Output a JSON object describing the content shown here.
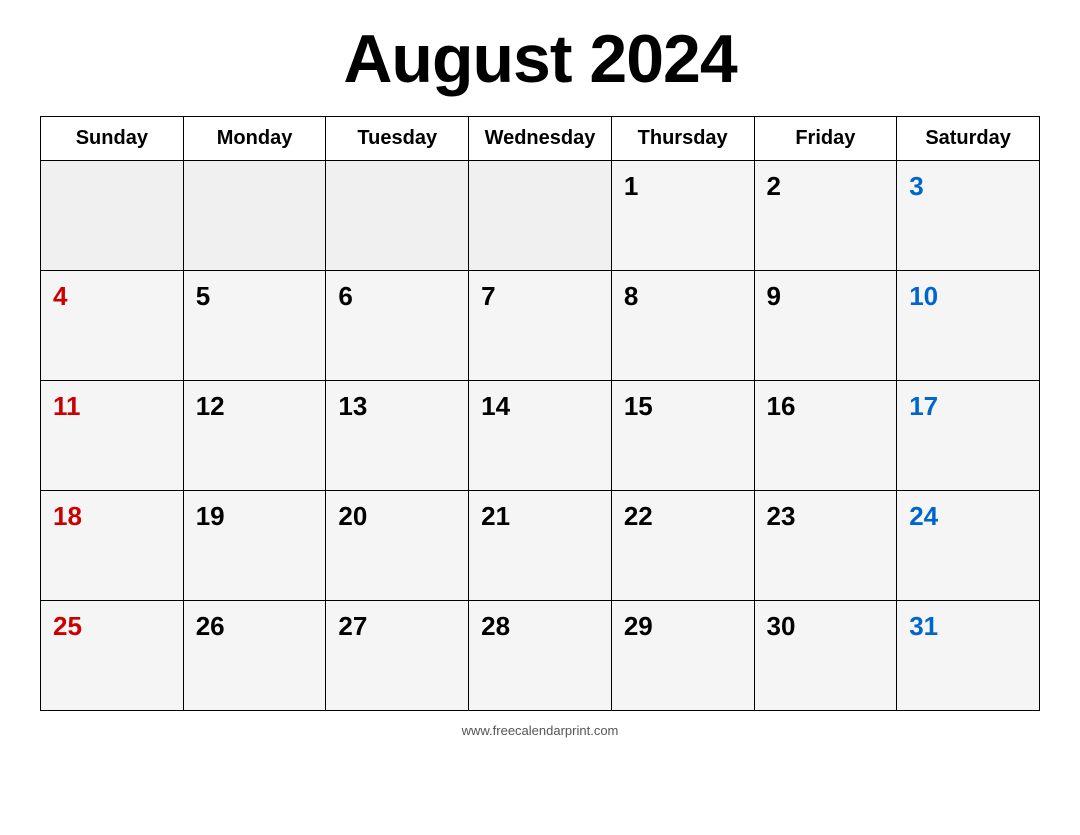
{
  "calendar": {
    "title": "August 2024",
    "days_of_week": [
      "Sunday",
      "Monday",
      "Tuesday",
      "Wednesday",
      "Thursday",
      "Friday",
      "Saturday"
    ],
    "weeks": [
      [
        {
          "day": "",
          "type": "empty"
        },
        {
          "day": "",
          "type": "empty"
        },
        {
          "day": "",
          "type": "empty"
        },
        {
          "day": "",
          "type": "empty"
        },
        {
          "day": "1",
          "type": "weekday"
        },
        {
          "day": "2",
          "type": "weekday"
        },
        {
          "day": "3",
          "type": "saturday"
        }
      ],
      [
        {
          "day": "4",
          "type": "sunday"
        },
        {
          "day": "5",
          "type": "weekday"
        },
        {
          "day": "6",
          "type": "weekday"
        },
        {
          "day": "7",
          "type": "weekday"
        },
        {
          "day": "8",
          "type": "weekday"
        },
        {
          "day": "9",
          "type": "weekday"
        },
        {
          "day": "10",
          "type": "saturday"
        }
      ],
      [
        {
          "day": "11",
          "type": "sunday"
        },
        {
          "day": "12",
          "type": "weekday"
        },
        {
          "day": "13",
          "type": "weekday"
        },
        {
          "day": "14",
          "type": "weekday"
        },
        {
          "day": "15",
          "type": "weekday"
        },
        {
          "day": "16",
          "type": "weekday"
        },
        {
          "day": "17",
          "type": "saturday"
        }
      ],
      [
        {
          "day": "18",
          "type": "sunday"
        },
        {
          "day": "19",
          "type": "weekday"
        },
        {
          "day": "20",
          "type": "weekday"
        },
        {
          "day": "21",
          "type": "weekday"
        },
        {
          "day": "22",
          "type": "weekday"
        },
        {
          "day": "23",
          "type": "weekday"
        },
        {
          "day": "24",
          "type": "saturday"
        }
      ],
      [
        {
          "day": "25",
          "type": "sunday"
        },
        {
          "day": "26",
          "type": "weekday"
        },
        {
          "day": "27",
          "type": "weekday"
        },
        {
          "day": "28",
          "type": "weekday"
        },
        {
          "day": "29",
          "type": "weekday"
        },
        {
          "day": "30",
          "type": "weekday"
        },
        {
          "day": "31",
          "type": "saturday"
        }
      ]
    ],
    "footer": "www.freecalendarprint.com"
  }
}
